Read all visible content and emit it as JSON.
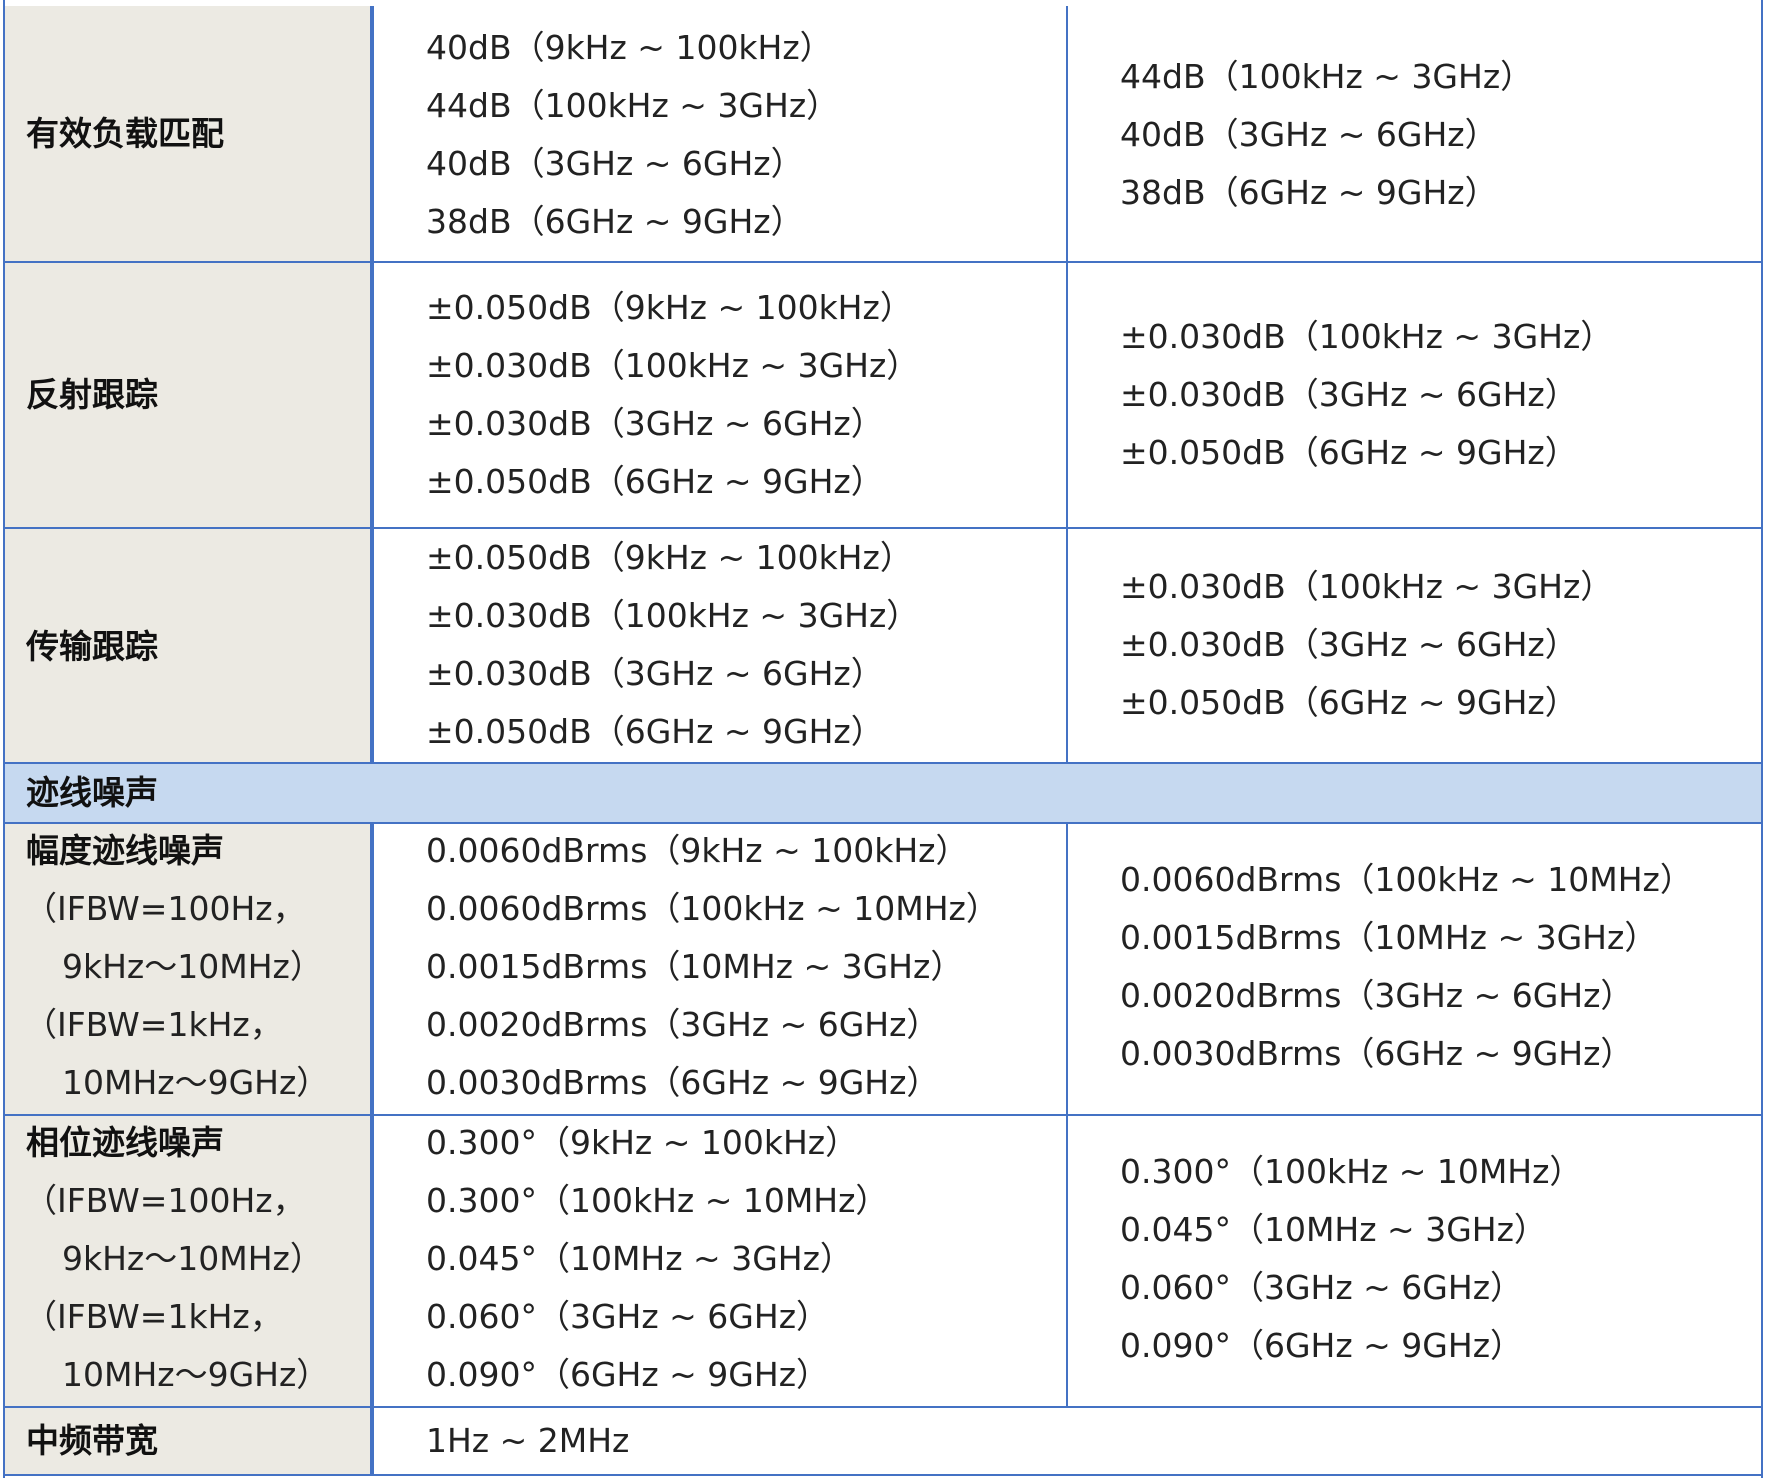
{
  "rows": [
    {
      "label": "有效负载匹配",
      "col1": [
        "40dB（9kHz ~ 100kHz）",
        "44dB（100kHz ~ 3GHz）",
        "40dB（3GHz ~ 6GHz）",
        "38dB（6GHz ~ 9GHz）"
      ],
      "col2": [
        "44dB（100kHz ~ 3GHz）",
        "40dB（3GHz ~ 6GHz）",
        "38dB（6GHz ~ 9GHz）"
      ]
    },
    {
      "label": "反射跟踪",
      "col1": [
        "±0.050dB（9kHz ~ 100kHz）",
        "±0.030dB（100kHz ~ 3GHz）",
        "±0.030dB（3GHz ~ 6GHz）",
        "±0.050dB（6GHz ~ 9GHz）"
      ],
      "col2": [
        "±0.030dB（100kHz ~ 3GHz）",
        "±0.030dB（3GHz ~ 6GHz）",
        "±0.050dB（6GHz ~ 9GHz）"
      ]
    },
    {
      "label": "传输跟踪",
      "col1": [
        "±0.050dB（9kHz ~ 100kHz）",
        "±0.030dB（100kHz ~ 3GHz）",
        "±0.030dB（3GHz ~ 6GHz）",
        "±0.050dB（6GHz ~ 9GHz）"
      ],
      "col2": [
        "±0.030dB（100kHz ~ 3GHz）",
        "±0.030dB（3GHz ~ 6GHz）",
        "±0.050dB（6GHz ~ 9GHz）"
      ]
    }
  ],
  "section": {
    "title": "迹线噪声"
  },
  "noise_rows": [
    {
      "label": "幅度迹线噪声",
      "label_lines": [
        "（IFBW=100Hz，",
        "9kHz～10MHz）",
        "（IFBW=1kHz，",
        "10MHz～9GHz）"
      ],
      "col1": [
        "0.0060dBrms（9kHz ~ 100kHz）",
        "0.0060dBrms（100kHz ~ 10MHz）",
        "0.0015dBrms（10MHz ~ 3GHz）",
        "0.0020dBrms（3GHz ~ 6GHz）",
        "0.0030dBrms（6GHz ~ 9GHz）"
      ],
      "col2": [
        "0.0060dBrms（100kHz ~ 10MHz）",
        "0.0015dBrms（10MHz ~ 3GHz）",
        "0.0020dBrms（3GHz ~ 6GHz）",
        "0.0030dBrms（6GHz ~ 9GHz）"
      ]
    },
    {
      "label": "相位迹线噪声",
      "label_lines": [
        "（IFBW=100Hz，",
        "9kHz～10MHz）",
        "（IFBW=1kHz，",
        "10MHz～9GHz）"
      ],
      "col1": [
        "0.300°（9kHz ~ 100kHz）",
        "0.300°（100kHz ~ 10MHz）",
        "0.045°（10MHz ~ 3GHz）",
        "0.060°（3GHz ~ 6GHz）",
        "0.090°（6GHz ~ 9GHz）"
      ],
      "col2": [
        "0.300°（100kHz ~ 10MHz）",
        "0.045°（10MHz ~ 3GHz）",
        "0.060°（3GHz ~ 6GHz）",
        "0.090°（6GHz ~ 9GHz）"
      ]
    }
  ],
  "if_bandwidth": {
    "label": "中频带宽",
    "value": "1Hz ~ 2MHz"
  },
  "colors": {
    "border": "#4472c4",
    "label_bg": "#eceae3",
    "section_bg": "#c6d9f0"
  }
}
